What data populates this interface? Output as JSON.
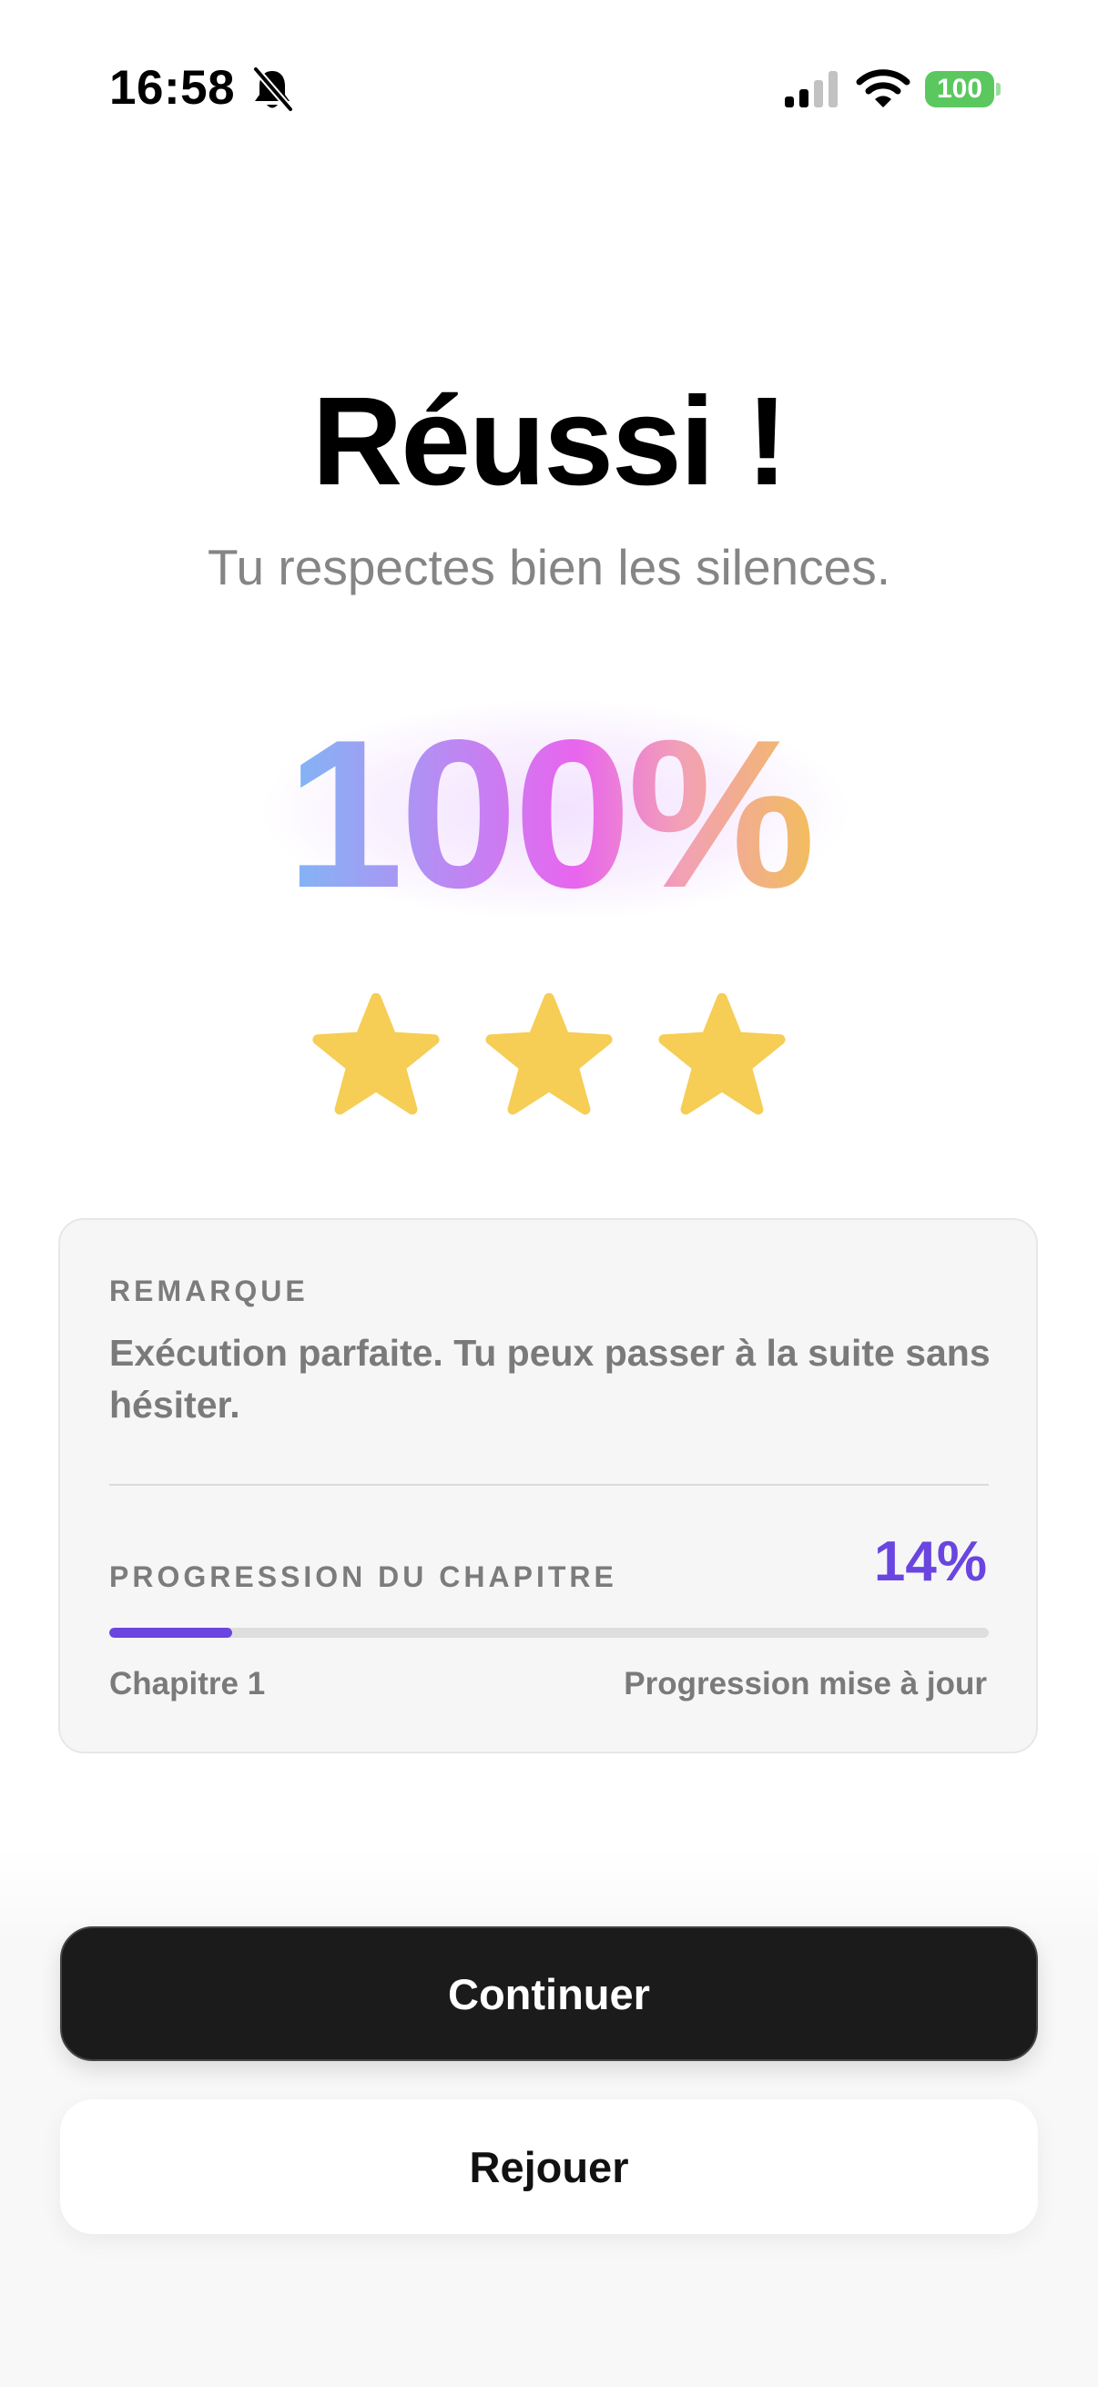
{
  "status_bar": {
    "time": "16:58",
    "battery_level": "100",
    "silent_mode": true,
    "signal_bars_active": 2,
    "signal_bars_total": 4,
    "battery_color": "#5bc85f"
  },
  "result": {
    "title": "Réussi !",
    "subtitle": "Tu respectes bien les silences.",
    "score": "100%",
    "stars_earned": 3,
    "stars_total": 3,
    "star_color": "#f6cd55"
  },
  "remark": {
    "heading": "REMARQUE",
    "text": "Exécution parfaite. Tu peux passer à la suite sans hésiter."
  },
  "progress": {
    "heading": "PROGRESSION DU CHAPITRE",
    "percent_label": "14%",
    "fraction": 0.14,
    "chapter_label": "Chapitre 1",
    "status": "Progression mise à jour",
    "accent_color": "#6a45e0"
  },
  "actions": {
    "continue_label": "Continuer",
    "replay_label": "Rejouer"
  }
}
